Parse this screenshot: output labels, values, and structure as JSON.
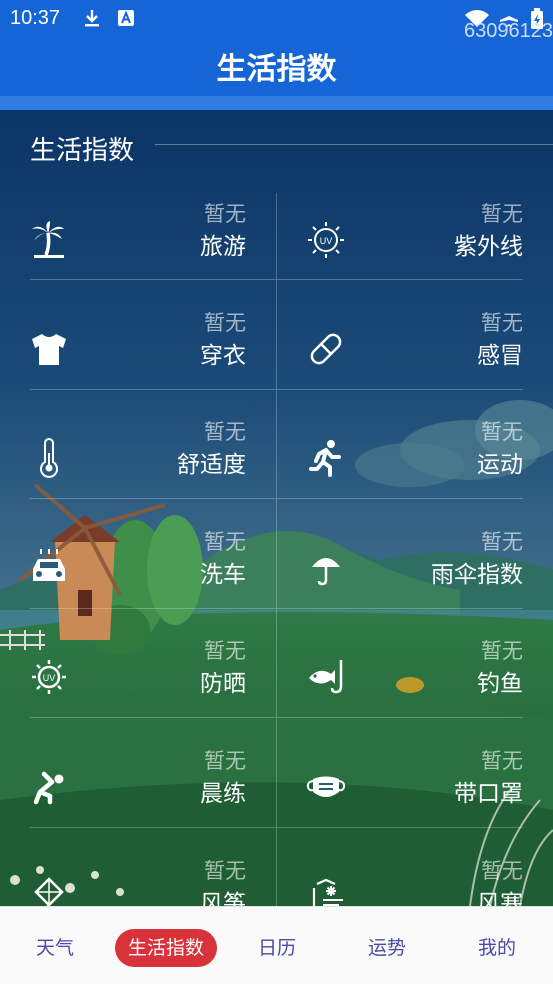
{
  "statusbar": {
    "time": "10:37",
    "code": "63096123"
  },
  "appbar": {
    "title": "生活指数"
  },
  "section": {
    "title": "生活指数"
  },
  "items": [
    {
      "status": "暂无",
      "name": "旅游",
      "icon": "palm-tree-icon"
    },
    {
      "status": "暂无",
      "name": "紫外线",
      "icon": "uv-sun-icon"
    },
    {
      "status": "暂无",
      "name": "穿衣",
      "icon": "tshirt-icon"
    },
    {
      "status": "暂无",
      "name": "感冒",
      "icon": "pill-icon"
    },
    {
      "status": "暂无",
      "name": "舒适度",
      "icon": "thermometer-icon"
    },
    {
      "status": "暂无",
      "name": "运动",
      "icon": "running-person-icon"
    },
    {
      "status": "暂无",
      "name": "洗车",
      "icon": "car-wash-icon"
    },
    {
      "status": "暂无",
      "name": "雨伞指数",
      "icon": "umbrella-icon"
    },
    {
      "status": "暂无",
      "name": "防晒",
      "icon": "sunscreen-uv-icon"
    },
    {
      "status": "暂无",
      "name": "钓鱼",
      "icon": "fishing-icon"
    },
    {
      "status": "暂无",
      "name": "晨练",
      "icon": "exercise-person-icon"
    },
    {
      "status": "暂无",
      "name": "带口罩",
      "icon": "face-mask-icon"
    },
    {
      "status": "暂无",
      "name": "风筝",
      "icon": "kite-icon"
    },
    {
      "status": "暂无",
      "name": "风寒",
      "icon": "wind-chill-icon"
    }
  ],
  "tabs": [
    {
      "label": "天气",
      "active": false
    },
    {
      "label": "生活指数",
      "active": true
    },
    {
      "label": "日历",
      "active": false
    },
    {
      "label": "运势",
      "active": false
    },
    {
      "label": "我的",
      "active": false
    }
  ],
  "colors": {
    "appbar": "#1565d6",
    "active_tab": "#d8323a",
    "tab_text": "#4a4aa8"
  }
}
